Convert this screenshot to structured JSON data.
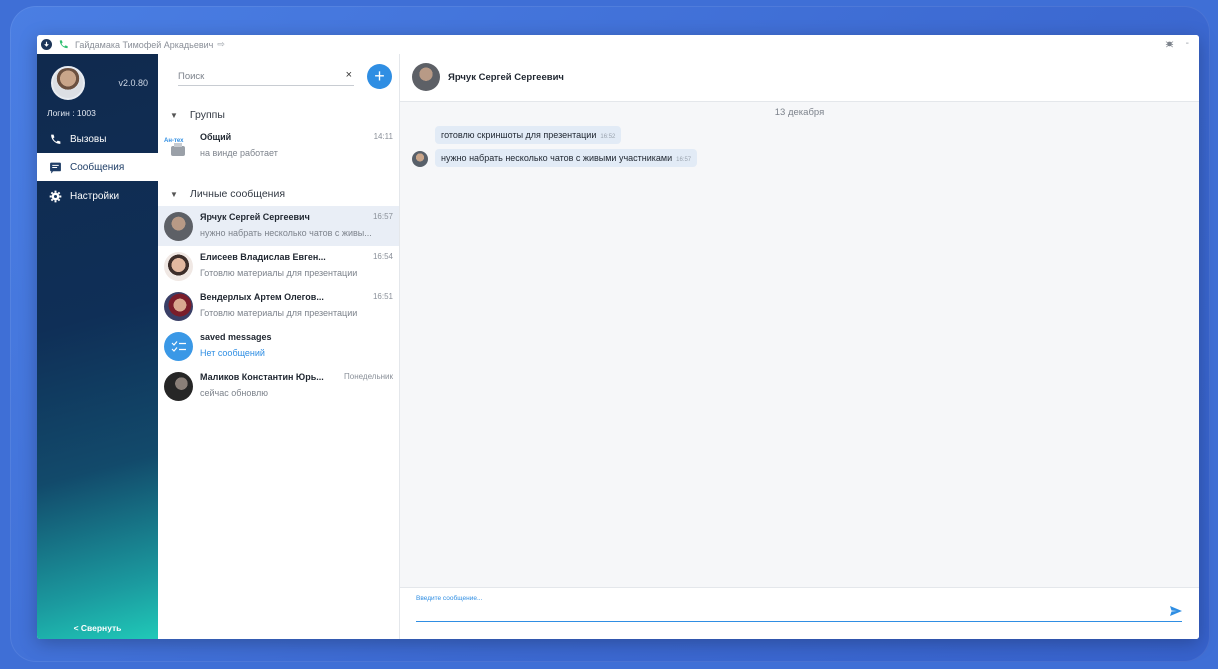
{
  "titlebar": {
    "user_name": "Гайдамака Тимофей Аркадьевич",
    "exit_icon": "⇨",
    "minimize": "-"
  },
  "sidebar": {
    "version": "v2.0.80",
    "login": "Логин : 1003",
    "items": [
      {
        "label": "Вызовы",
        "icon": "phone-icon"
      },
      {
        "label": "Сообщения",
        "icon": "chat-icon"
      },
      {
        "label": "Настройки",
        "icon": "gear-icon"
      }
    ],
    "collapse": "< Свернуть"
  },
  "list": {
    "search_placeholder": "Поиск",
    "clear": "×",
    "add": "+",
    "groups_header": "Группы",
    "private_header": "Личные сообщения",
    "groups": [
      {
        "name": "Общий",
        "time": "14:11",
        "preview": "на винде работает",
        "logo_text": "Ан-тех"
      }
    ],
    "chats": [
      {
        "name": "Ярчук Сергей Сергеевич",
        "time": "16:57",
        "preview": "нужно набрать несколько чатов с живы..."
      },
      {
        "name": "Елисеев Владислав Евген...",
        "time": "16:54",
        "preview": "Готовлю материалы для презентации"
      },
      {
        "name": "Вендерлых Артем Олегов...",
        "time": "16:51",
        "preview": "Готовлю материалы для презентации"
      },
      {
        "name": "saved messages",
        "time": "",
        "preview": "Нет сообщений"
      },
      {
        "name": "Маликов Константин Юрь...",
        "time": "Понедельник",
        "preview": "сейчас обновлю"
      }
    ]
  },
  "conversation": {
    "title": "Ярчук Сергей Сергеевич",
    "date": "13 декабря",
    "messages": [
      {
        "text": "готовлю скриншоты для презентации",
        "time": "16:52"
      },
      {
        "text": "нужно набрать несколько чатов с живыми участниками",
        "time": "16:57"
      }
    ],
    "composer_label": "Введите сообщение..."
  },
  "colors": {
    "accent": "#2f8ee3",
    "sidebar_top": "#102a4e",
    "sidebar_bottom": "#20c9b8",
    "background": "#3f6fd6"
  }
}
